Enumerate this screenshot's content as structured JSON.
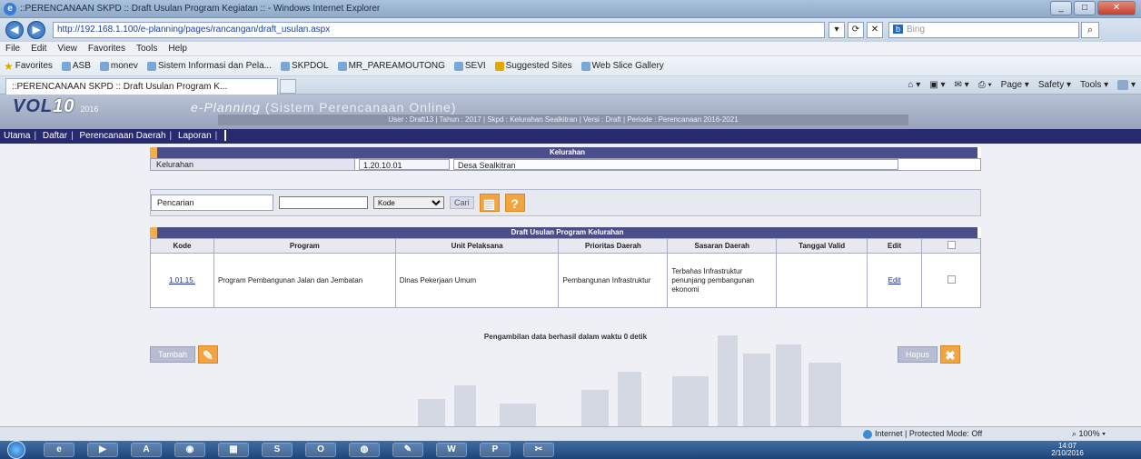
{
  "window": {
    "title": "::PERENCANAAN SKPD :: Draft Usulan Program Kegiatan :: - Windows Internet Explorer",
    "url": "http://192.168.1.100/e-planning/pages/rancangan/draft_usulan.aspx",
    "search_placeholder": "Bing",
    "menu": [
      "File",
      "Edit",
      "View",
      "Favorites",
      "Tools",
      "Help"
    ],
    "favorites_label": "Favorites",
    "favorites": [
      "ASB",
      "monev",
      "Sistem Informasi dan Pela...",
      "SKPDOL",
      "MR_PAREAMOUTONG",
      "SEVI",
      "Suggested Sites",
      "Web Slice Gallery"
    ],
    "tab_title": "::PERENCANAAN SKPD :: Draft Usulan Program K...",
    "commands": [
      "Page",
      "Safety",
      "Tools"
    ]
  },
  "header": {
    "logo_text": "VOL",
    "logo_accent": "10",
    "logo_version": "2016",
    "app_title_prefix": "e-Planning",
    "app_title": "(Sistem Perencanaan Online)",
    "info_line": "User : Draft13 | Tahun : 2017 | Skpd : Kelurahan Sealkitran | Versi : Draft | Periode : Perencanaan 2016-2021"
  },
  "nav": {
    "items": [
      "Utama",
      "Daftar",
      "Perencanaan Daerah",
      "Laporan"
    ]
  },
  "kelurahan": {
    "section_title": "Kelurahan",
    "label": "Kelurahan",
    "code": "1.20.10.01",
    "name": "Desa Sealkitran"
  },
  "search": {
    "label": "Pencarian",
    "value": "",
    "select_value": "Kode",
    "button": "Cari",
    "help_icon": "?"
  },
  "program_table": {
    "section_title": "Draft Usulan Program Kelurahan",
    "columns": [
      "Kode",
      "Program",
      "Unit Pelaksana",
      "Prioritas Daerah",
      "Sasaran Daerah",
      "Tanggal Valid",
      "Edit",
      ""
    ],
    "rows": [
      {
        "kode": "1.01.15.",
        "program": "Program Pembangunan Jalan dan Jembatan",
        "unit": "Dinas Pekerjaan Umum",
        "prioritas": "Pembangunan Infrastruktur",
        "sasaran": "Terbahas Infrastruktur penunjang pembangunan ekonomi",
        "tanggal": "",
        "edit": "Edit"
      }
    ]
  },
  "footer_msg": "Pengambilan data berhasil dalam waktu 0 detik",
  "actions": {
    "tambah": "Tambah",
    "hapus": "Hapus"
  },
  "status": {
    "zone": "Internet | Protected Mode: Off",
    "zoom": "100%"
  },
  "taskbar": {
    "time": "14:07",
    "date": "2/10/2016"
  }
}
